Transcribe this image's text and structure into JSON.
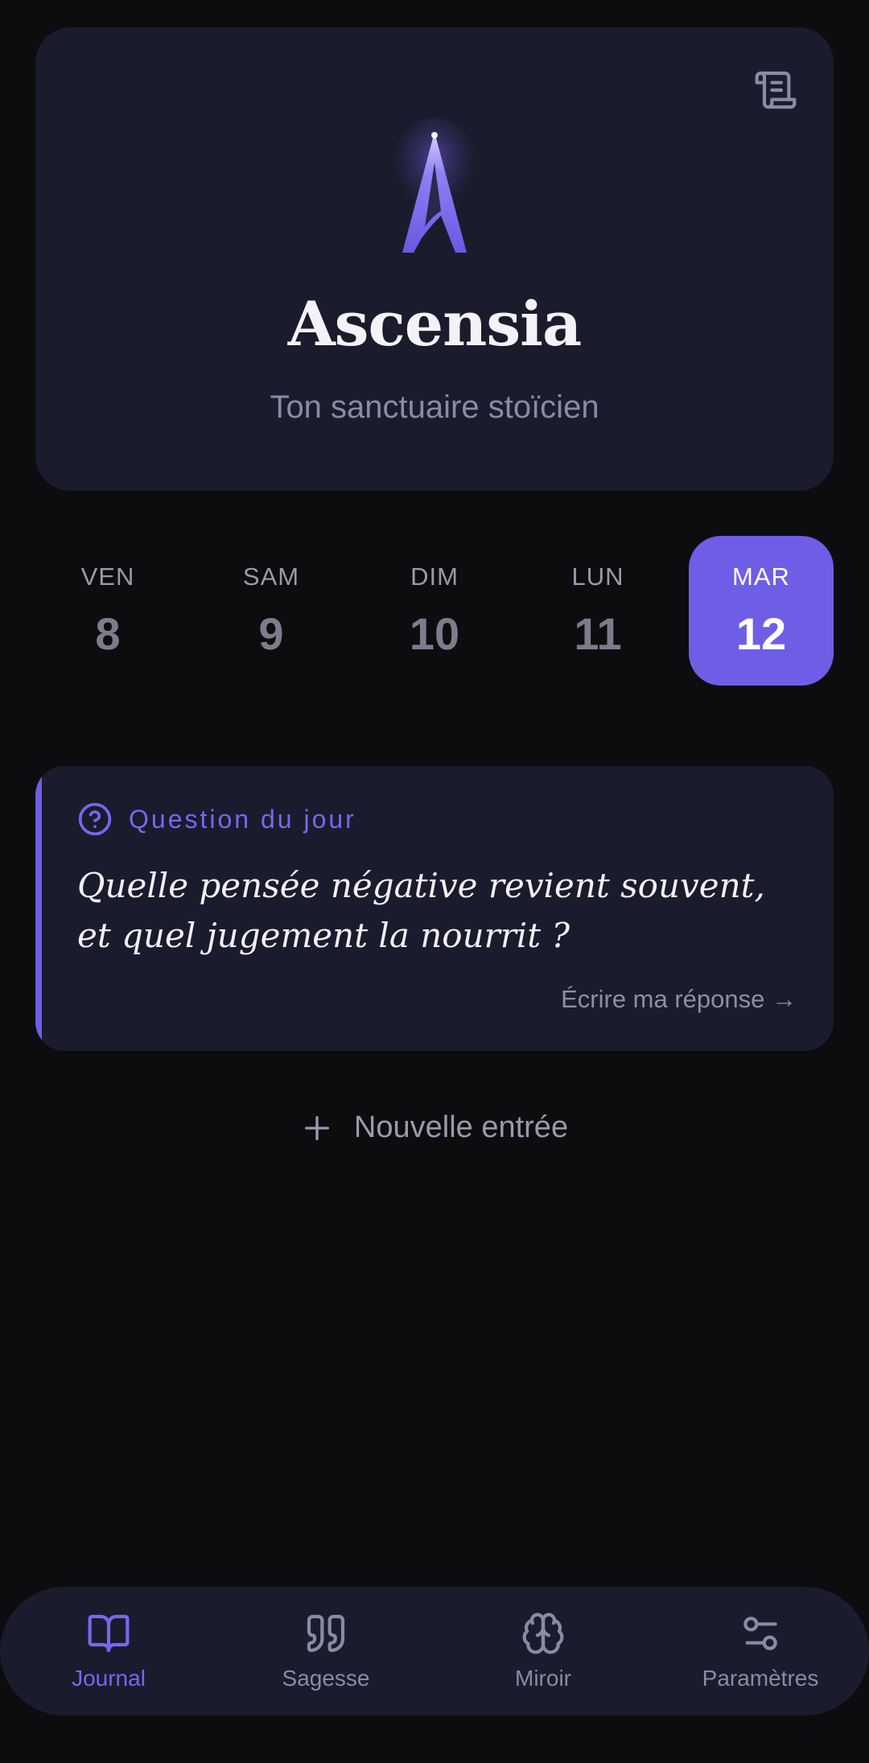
{
  "app": {
    "title": "Ascensia",
    "subtitle": "Ton sanctuaire stoïcien",
    "top_action_icon": "scroll-icon",
    "logo_icon": "ascensia-logo-icon"
  },
  "days": [
    {
      "name": "VEN",
      "number": "8",
      "selected": false
    },
    {
      "name": "SAM",
      "number": "9",
      "selected": false
    },
    {
      "name": "DIM",
      "number": "10",
      "selected": false
    },
    {
      "name": "LUN",
      "number": "11",
      "selected": false
    },
    {
      "name": "MAR",
      "number": "12",
      "selected": true
    }
  ],
  "question": {
    "label": "Question du jour",
    "text": "Quelle pensée négative revient souvent, et quel jugement la nourrit ?",
    "action": "Écrire ma réponse →",
    "icon": "question-circle-icon"
  },
  "new_entry": {
    "label": "Nouvelle entrée",
    "icon": "plus-icon"
  },
  "nav": [
    {
      "label": "Journal",
      "icon": "book-open-icon",
      "active": true
    },
    {
      "label": "Sagesse",
      "icon": "quote-icon",
      "active": false
    },
    {
      "label": "Miroir",
      "icon": "brain-icon",
      "active": false
    },
    {
      "label": "Paramètres",
      "icon": "sliders-icon",
      "active": false
    }
  ],
  "colors": {
    "background": "#0d0d0f",
    "card": "#1b1b2e",
    "accent": "#6e5ee6",
    "accent_text": "#7a66ee",
    "muted_text": "#8b8ba0"
  }
}
